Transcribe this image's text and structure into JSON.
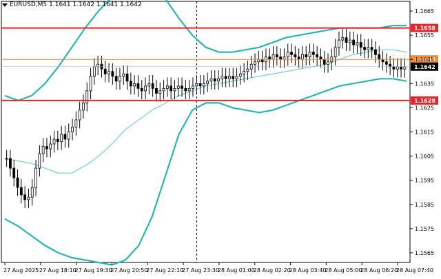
{
  "header": {
    "symbol": "EURUSD,M5",
    "ohlc": "1.1641 1.1642 1.1641 1.1642"
  },
  "colors": {
    "background": "#ffffff",
    "candle": "#000000",
    "bollinger": "#29b3b3",
    "ma": "#5cc7c7",
    "level_red": "#e3262b",
    "level_orange": "#f28a35",
    "current_price_bg": "#000000",
    "grid_axis": "#000000",
    "crosshair": "#000000"
  },
  "chart_data": {
    "type": "candlestick",
    "title": "",
    "y_axis_position": "right",
    "ylim": [
      1.1561,
      1.1669
    ],
    "y_ticks": [
      "1.1665",
      "1.1655",
      "1.1645",
      "1.1635",
      "1.1625",
      "1.1615",
      "1.1605",
      "1.1595",
      "1.1585",
      "1.1575",
      "1.1565"
    ],
    "y_tick_values": [
      1.1665,
      1.1655,
      1.1645,
      1.1635,
      1.1625,
      1.1615,
      1.1605,
      1.1595,
      1.1585,
      1.1575,
      1.1565
    ],
    "x_ticks": [
      "27 Aug 2025",
      "27 Aug 18:10",
      "27 Aug 19:30",
      "27 Aug 20:50",
      "27 Aug 22:10",
      "27 Aug 23:30",
      "28 Aug 01:00",
      "28 Aug 02:20",
      "28 Aug 03:40",
      "28 Aug 05:00",
      "28 Aug 06:20",
      "28 Aug 07:40"
    ],
    "x_tick_index": [
      0,
      16,
      32,
      48,
      64,
      80,
      96,
      112,
      128,
      144,
      160,
      176
    ],
    "candles_close": [
      1.1604,
      1.16,
      1.1596,
      1.1592,
      1.1589,
      1.1587,
      1.1588,
      1.1592,
      1.16,
      1.1606,
      1.1609,
      1.1608,
      1.161,
      1.1612,
      1.1611,
      1.1614,
      1.1612,
      1.1615,
      1.1617,
      1.162,
      1.1624,
      1.1627,
      1.1632,
      1.1638,
      1.1642,
      1.1643,
      1.1641,
      1.1639,
      1.164,
      1.1638,
      1.1636,
      1.1638,
      1.1639,
      1.1636,
      1.1634,
      1.1635,
      1.1633,
      1.1632,
      1.1634,
      1.1635,
      1.1633,
      1.1631,
      1.1632,
      1.1633,
      1.1634,
      1.1632,
      1.1633,
      1.1634,
      1.1633,
      1.1632,
      1.1633,
      1.1634,
      1.1635,
      1.1634,
      1.1635,
      1.1636,
      1.1637,
      1.1636,
      1.1637,
      1.1638,
      1.1637,
      1.1638,
      1.1637,
      1.1638,
      1.1639,
      1.164,
      1.1641,
      1.1643,
      1.1644,
      1.1645,
      1.1644,
      1.1646,
      1.1645,
      1.1647,
      1.1646,
      1.1645,
      1.1646,
      1.1648,
      1.1647,
      1.1646,
      1.1645,
      1.1647,
      1.1646,
      1.1648,
      1.1647,
      1.1646,
      1.1645,
      1.1643,
      1.1644,
      1.1646,
      1.165,
      1.1653,
      1.1654,
      1.1652,
      1.1653,
      1.1651,
      1.1652,
      1.165,
      1.1649,
      1.165,
      1.1649,
      1.1647,
      1.1645,
      1.1644,
      1.1643,
      1.1642,
      1.1641,
      1.1642,
      1.1641,
      1.1642
    ],
    "price_labels": {
      "upper_red": "1.1658",
      "orange": "1.1645",
      "current": "1.1642",
      "lower_red": "1.1628"
    },
    "levels": {
      "upper_red": 1.1658,
      "orange": 1.1645,
      "lower_red": 1.1628,
      "current": 1.1642
    },
    "bollinger_upper": [
      1.163,
      1.1628,
      1.163,
      1.1635,
      1.1642,
      1.165,
      1.1658,
      1.1665,
      1.1671,
      1.1676,
      1.1678,
      1.1676,
      1.167,
      1.1662,
      1.1655,
      1.165,
      1.1648,
      1.1648,
      1.1649,
      1.165,
      1.1652,
      1.1654,
      1.1655,
      1.1656,
      1.1657,
      1.1658,
      1.1658,
      1.1658,
      1.1658,
      1.1659,
      1.1659
    ],
    "bollinger_lower": [
      1.1579,
      1.1576,
      1.1572,
      1.1568,
      1.1565,
      1.1563,
      1.1562,
      1.1561,
      1.156,
      1.1562,
      1.1568,
      1.158,
      1.1597,
      1.1614,
      1.1624,
      1.1627,
      1.1627,
      1.1625,
      1.1624,
      1.1623,
      1.1624,
      1.1626,
      1.1628,
      1.163,
      1.1632,
      1.1634,
      1.1635,
      1.1636,
      1.1637,
      1.1637,
      1.1636
    ],
    "ma": [
      1.1604,
      1.1603,
      1.1602,
      1.16,
      1.1598,
      1.1598,
      1.1601,
      1.1605,
      1.161,
      1.1616,
      1.162,
      1.1624,
      1.1627,
      1.163,
      1.1632,
      1.1634,
      1.1635,
      1.1636,
      1.1637,
      1.1638,
      1.1639,
      1.164,
      1.1641,
      1.1642,
      1.1643,
      1.1645,
      1.1647,
      1.1648,
      1.1649,
      1.1649,
      1.1648
    ]
  }
}
